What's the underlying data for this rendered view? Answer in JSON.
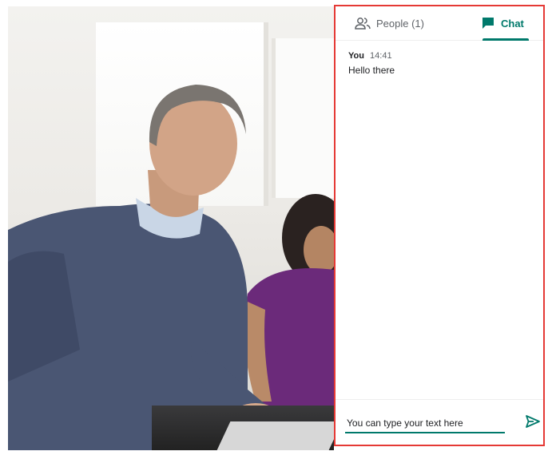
{
  "tabs": [
    {
      "label": "People (1)",
      "icon": "people-icon",
      "active": false
    },
    {
      "label": "Chat",
      "icon": "chat-icon",
      "active": true
    }
  ],
  "messages": [
    {
      "sender": "You",
      "time": "14:41",
      "text": "Hello there"
    }
  ],
  "composer": {
    "value": "You can type your text here",
    "send_icon": "send-icon"
  },
  "colors": {
    "accent": "#00796b",
    "panel_border": "#e53935",
    "muted_text": "#5f6368"
  }
}
